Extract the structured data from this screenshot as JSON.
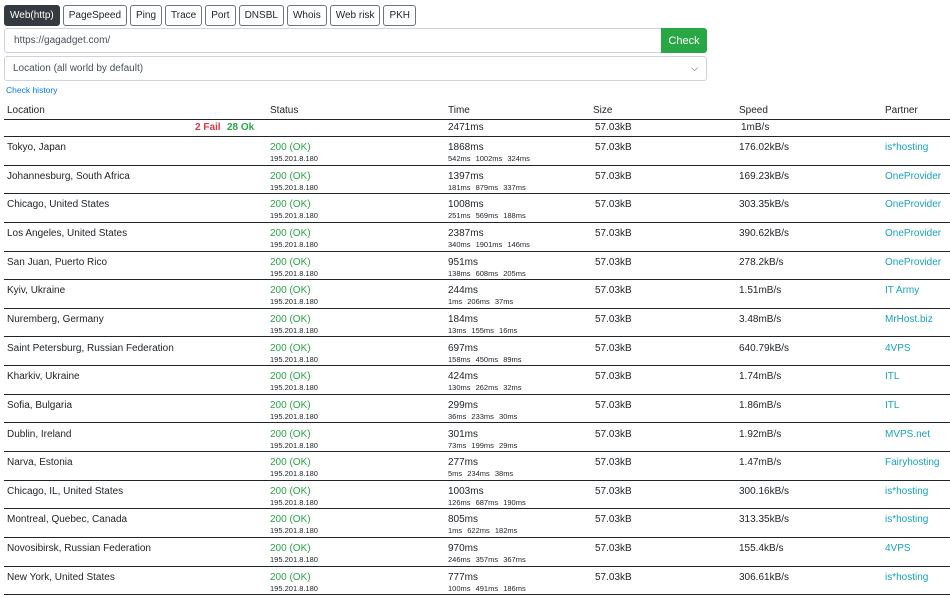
{
  "tabs": [
    "Web(http)",
    "PageSpeed",
    "Ping",
    "Trace",
    "Port",
    "DNSBL",
    "Whois",
    "Web risk",
    "PKH"
  ],
  "active_tab": 0,
  "url_input": {
    "value": "https://gagadget.com/"
  },
  "check_button": "Check",
  "location_select": {
    "value": "Location (all world by default)"
  },
  "check_history": "Check history",
  "columns": {
    "location": "Location",
    "status": "Status",
    "time": "Time",
    "size": "Size",
    "speed": "Speed",
    "partner": "Partner"
  },
  "summary": {
    "fail": "2 Fail",
    "ok": "28 Ok",
    "time": "2471ms",
    "size": "57.03kB",
    "speed": "1mB/s"
  },
  "rows": [
    {
      "location": "Tokyo, Japan",
      "status": "200 (OK)",
      "ip": "195.201.8.180",
      "time": "1868ms",
      "sub": "542ms 1002ms 324ms",
      "size": "57.03kB",
      "speed": "176.02kB/s",
      "partner": "is*hosting"
    },
    {
      "location": "Johannesburg, South Africa",
      "status": "200 (OK)",
      "ip": "195.201.8.180",
      "time": "1397ms",
      "sub": "181ms 879ms 337ms",
      "size": "57.03kB",
      "speed": "169.23kB/s",
      "partner": "OneProvider"
    },
    {
      "location": "Chicago, United States",
      "status": "200 (OK)",
      "ip": "195.201.8.180",
      "time": "1008ms",
      "sub": "251ms 569ms 188ms",
      "size": "57.03kB",
      "speed": "303.35kB/s",
      "partner": "OneProvider"
    },
    {
      "location": "Los Angeles, United States",
      "status": "200 (OK)",
      "ip": "195.201.8.180",
      "time": "2387ms",
      "sub": "340ms 1901ms 146ms",
      "size": "57.03kB",
      "speed": "390.62kB/s",
      "partner": "OneProvider"
    },
    {
      "location": "San Juan, Puerto Rico",
      "status": "200 (OK)",
      "ip": "195.201.8.180",
      "time": "951ms",
      "sub": "138ms 608ms 205ms",
      "size": "57.03kB",
      "speed": "278.2kB/s",
      "partner": "OneProvider"
    },
    {
      "location": "Kyiv, Ukraine",
      "status": "200 (OK)",
      "ip": "195.201.8.180",
      "time": "244ms",
      "sub": "1ms 206ms 37ms",
      "size": "57.03kB",
      "speed": "1.51mB/s",
      "partner": "IT Army"
    },
    {
      "location": "Nuremberg, Germany",
      "status": "200 (OK)",
      "ip": "195.201.8.180",
      "time": "184ms",
      "sub": "13ms 155ms 16ms",
      "size": "57.03kB",
      "speed": "3.48mB/s",
      "partner": "MrHost.biz"
    },
    {
      "location": "Saint Petersburg, Russian Federation",
      "status": "200 (OK)",
      "ip": "195.201.8.180",
      "time": "697ms",
      "sub": "158ms 450ms 89ms",
      "size": "57.03kB",
      "speed": "640.79kB/s",
      "partner": "4VPS"
    },
    {
      "location": "Kharkiv, Ukraine",
      "status": "200 (OK)",
      "ip": "195.201.8.180",
      "time": "424ms",
      "sub": "130ms 262ms 32ms",
      "size": "57.03kB",
      "speed": "1.74mB/s",
      "partner": "ITL"
    },
    {
      "location": "Sofia, Bulgaria",
      "status": "200 (OK)",
      "ip": "195.201.8.180",
      "time": "299ms",
      "sub": "36ms 233ms 30ms",
      "size": "57.03kB",
      "speed": "1.86mB/s",
      "partner": "ITL"
    },
    {
      "location": "Dublin, Ireland",
      "status": "200 (OK)",
      "ip": "195.201.8.180",
      "time": "301ms",
      "sub": "73ms 199ms 29ms",
      "size": "57.03kB",
      "speed": "1.92mB/s",
      "partner": "MVPS.net"
    },
    {
      "location": "Narva, Estonia",
      "status": "200 (OK)",
      "ip": "195.201.8.180",
      "time": "277ms",
      "sub": "5ms 234ms 38ms",
      "size": "57.03kB",
      "speed": "1.47mB/s",
      "partner": "Fairyhosting"
    },
    {
      "location": "Chicago, IL, United States",
      "status": "200 (OK)",
      "ip": "195.201.8.180",
      "time": "1003ms",
      "sub": "126ms 687ms 190ms",
      "size": "57.03kB",
      "speed": "300.16kB/s",
      "partner": "is*hosting"
    },
    {
      "location": "Montreal, Quebec, Canada",
      "status": "200 (OK)",
      "ip": "195.201.8.180",
      "time": "805ms",
      "sub": "1ms 622ms 182ms",
      "size": "57.03kB",
      "speed": "313.35kB/s",
      "partner": "is*hosting"
    },
    {
      "location": "Novosibirsk, Russian Federation",
      "status": "200 (OK)",
      "ip": "195.201.8.180",
      "time": "970ms",
      "sub": "246ms 357ms 367ms",
      "size": "57.03kB",
      "speed": "155.4kB/s",
      "partner": "4VPS"
    },
    {
      "location": "New York, United States",
      "status": "200 (OK)",
      "ip": "195.201.8.180",
      "time": "777ms",
      "sub": "100ms 491ms 186ms",
      "size": "57.03kB",
      "speed": "306.61kB/s",
      "partner": "is*hosting"
    }
  ]
}
